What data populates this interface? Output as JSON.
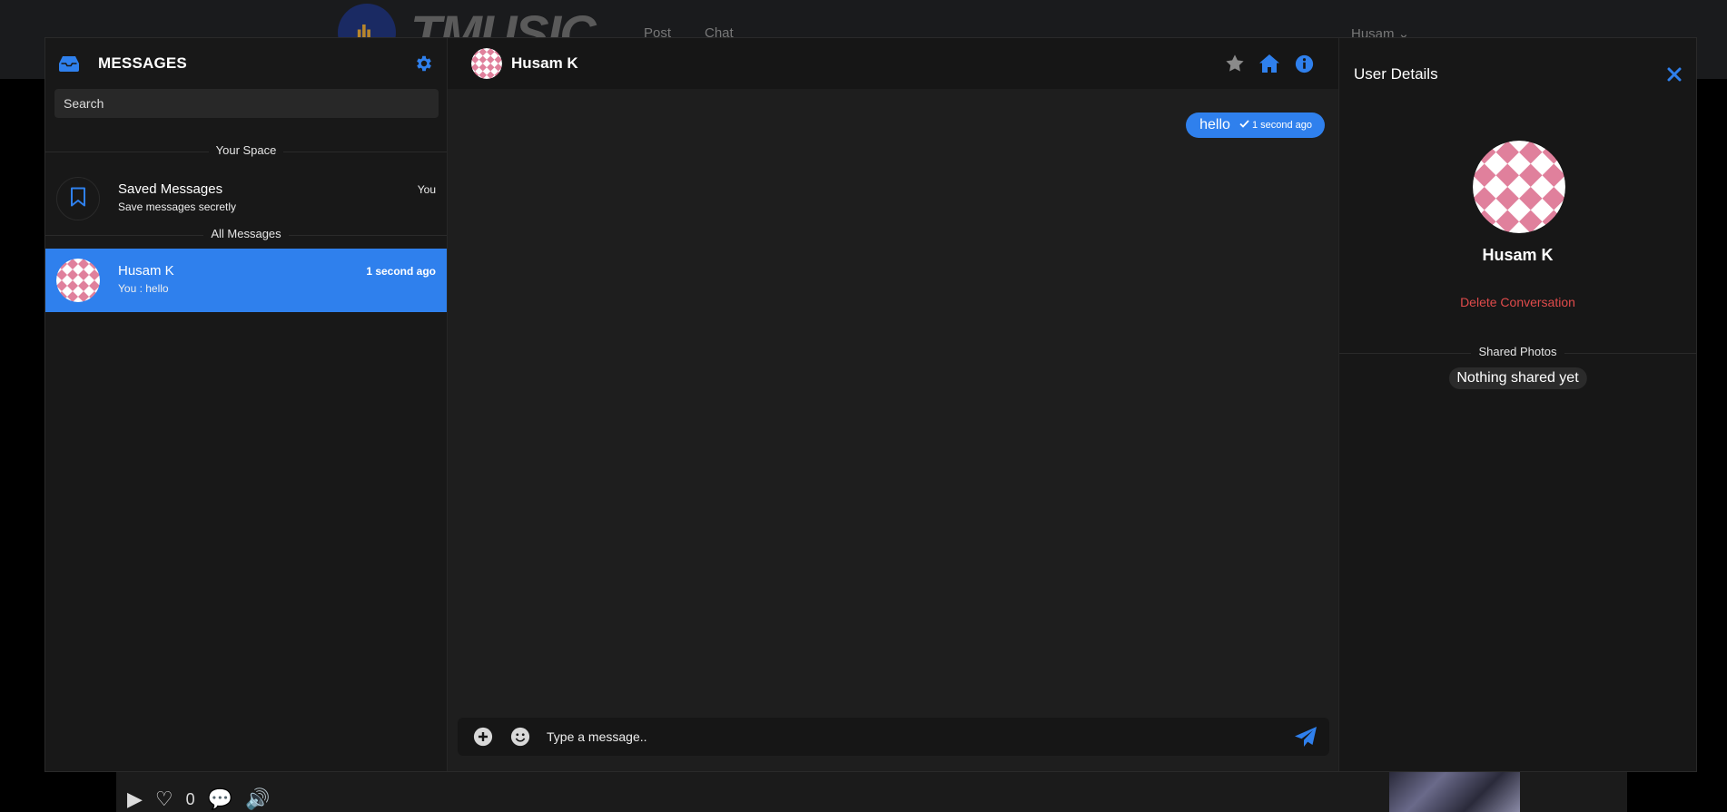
{
  "background": {
    "logo_text": "TMUSIC",
    "nav": [
      "Post",
      "Chat"
    ],
    "user": "Husam",
    "like_count": "0"
  },
  "sidebar": {
    "title": "MESSAGES",
    "search_placeholder": "Search",
    "your_space_label": "Your Space",
    "saved": {
      "name": "Saved Messages",
      "sub": "Save messages secretly",
      "meta": "You"
    },
    "all_messages_label": "All Messages",
    "conversations": [
      {
        "name": "Husam K",
        "preview": "You : hello",
        "time": "1 second ago",
        "active": true
      }
    ]
  },
  "chat": {
    "contact_name": "Husam K",
    "messages": [
      {
        "text": "hello",
        "time": "1 second ago",
        "sent": true
      }
    ],
    "composer_placeholder": "Type a message.."
  },
  "details": {
    "title": "User Details",
    "name": "Husam K",
    "delete_label": "Delete Conversation",
    "shared_label": "Shared Photos",
    "shared_empty": "Nothing shared yet"
  },
  "colors": {
    "accent": "#2f80ed",
    "danger": "#e04b4b",
    "avatar_pink": "#e0809c"
  },
  "icons": [
    "inbox-icon",
    "gear-icon",
    "bookmark-icon",
    "star-icon",
    "home-icon",
    "info-icon",
    "check-icon",
    "plus-circle-icon",
    "smile-icon",
    "send-icon",
    "close-icon"
  ]
}
